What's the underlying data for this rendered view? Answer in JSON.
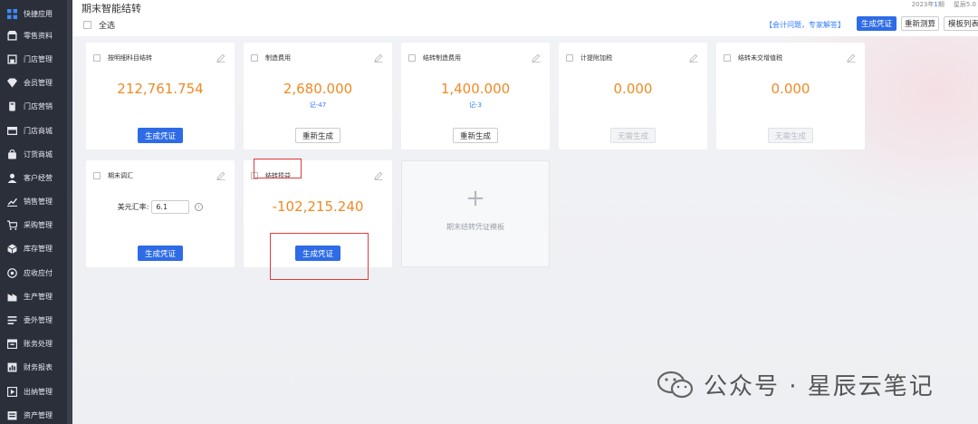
{
  "sidebar": {
    "items": [
      {
        "label": "快捷应用",
        "icon": "grid-icon"
      },
      {
        "label": "零售资料",
        "icon": "shop-icon"
      },
      {
        "label": "门店管理",
        "icon": "store-icon"
      },
      {
        "label": "会员管理",
        "icon": "diamond-icon"
      },
      {
        "label": "门店营销",
        "icon": "tag-icon"
      },
      {
        "label": "门店商城",
        "icon": "mall-icon"
      },
      {
        "label": "订货商城",
        "icon": "bag-icon"
      },
      {
        "label": "客户经营",
        "icon": "user-icon"
      },
      {
        "label": "销售管理",
        "icon": "chart-icon"
      },
      {
        "label": "采购管理",
        "icon": "cart-icon"
      },
      {
        "label": "库存管理",
        "icon": "box-icon"
      },
      {
        "label": "应收应付",
        "icon": "money-icon"
      },
      {
        "label": "生产管理",
        "icon": "factory-icon"
      },
      {
        "label": "委外管理",
        "icon": "list-icon"
      },
      {
        "label": "账务处理",
        "icon": "ledger-icon"
      },
      {
        "label": "财务报表",
        "icon": "report-icon"
      },
      {
        "label": "出纳管理",
        "icon": "cash-icon"
      },
      {
        "label": "资产管理",
        "icon": "asset-icon"
      }
    ]
  },
  "header": {
    "title": "期末智能结转",
    "select_all": "全选",
    "period_prefix": "2023年",
    "period_num": "1",
    "period_suffix": "期",
    "user": "星辰5.0",
    "help_link": "【会计问题，专家解答】",
    "btn_generate": "生成凭证",
    "btn_recalc": "重新测算",
    "btn_template": "模板列表"
  },
  "cards": [
    {
      "title": "按明细科目结转",
      "value": "212,761.754",
      "ref": "",
      "button": "生成凭证",
      "button_style": "primary"
    },
    {
      "title": "制造费用",
      "value": "2,680.000",
      "ref": "记-47",
      "button": "重新生成",
      "button_style": "default"
    },
    {
      "title": "结转制造费用",
      "value": "1,400.000",
      "ref": "记-3",
      "button": "重新生成",
      "button_style": "default"
    },
    {
      "title": "计提附加税",
      "value": "0.000",
      "ref": "",
      "button": "无需生成",
      "button_style": "disabled"
    },
    {
      "title": "结转未交增值税",
      "value": "0.000",
      "ref": "",
      "button": "无需生成",
      "button_style": "disabled"
    },
    {
      "title": "期末调汇",
      "rate_label": "美元汇率:",
      "rate_value": "6.1",
      "button": "生成凭证",
      "button_style": "primary"
    },
    {
      "title": "结转损益",
      "value": "-102,215.240",
      "ref": "",
      "button": "生成凭证",
      "button_style": "primary"
    }
  ],
  "add_card": {
    "label": "期末结转凭证模板"
  },
  "watermark": {
    "text": "公众号 · 星辰云笔记"
  },
  "colors": {
    "accent": "#2e6be6",
    "value_orange": "#f08a24",
    "highlight_red": "#e33b3b",
    "sidebar_bg": "#2b2f3a"
  }
}
